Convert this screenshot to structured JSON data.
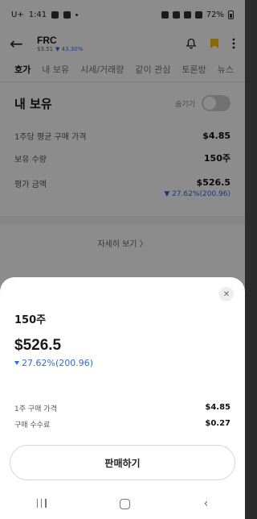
{
  "status_bar": {
    "carrier": "U+",
    "time": "1:41",
    "battery": "72%"
  },
  "header": {
    "title": "FRC",
    "price": "$3.51",
    "change": "▼ 43.30%"
  },
  "tabs": [
    "호가",
    "내 보유",
    "시세/거래량",
    "같이 관심",
    "토론방",
    "뉴스"
  ],
  "holdings": {
    "title": "내 보유",
    "hide_label": "숨기기",
    "avg_price_label": "1주당 평균 구매 가격",
    "avg_price": "$4.85",
    "quantity_label": "보유 수량",
    "quantity": "150주",
    "eval_label": "평가 금액",
    "eval_amount": "$526.5",
    "eval_change": "▼ 27.62%(200.96)",
    "more_label": "자세히 보기 〉"
  },
  "sheet": {
    "quantity": "150주",
    "amount": "$526.5",
    "change": "27.62%(200.96)",
    "price_label": "1주 구매 가격",
    "price_value": "$4.85",
    "fee_label": "구매 수수료",
    "fee_value": "$0.27",
    "sell_label": "판매하기"
  },
  "nav": {
    "back": "‹"
  },
  "colors": {
    "accent_blue": "#2f6bdb",
    "bookmark_yellow": "#f5c400"
  }
}
